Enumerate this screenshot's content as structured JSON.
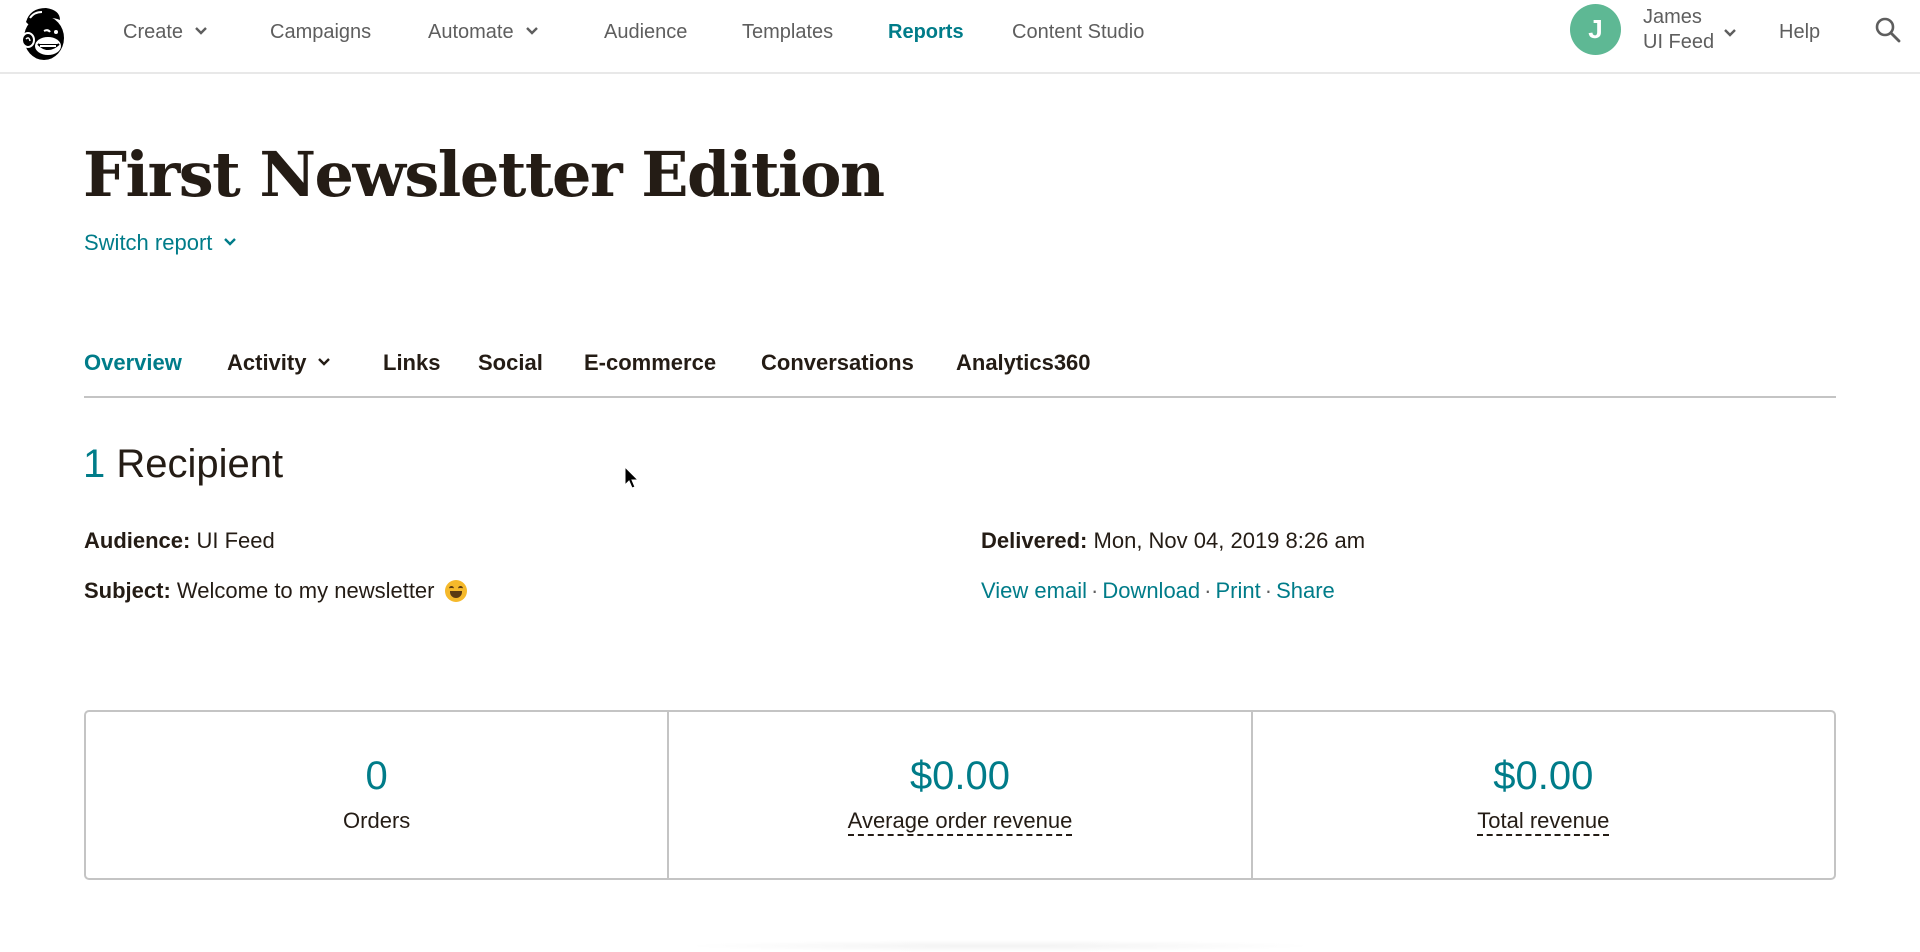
{
  "nav": {
    "logo_label": "Mailchimp",
    "items": [
      {
        "label": "Create",
        "has_dropdown": true
      },
      {
        "label": "Campaigns",
        "has_dropdown": false
      },
      {
        "label": "Automate",
        "has_dropdown": true
      },
      {
        "label": "Audience",
        "has_dropdown": false
      },
      {
        "label": "Templates",
        "has_dropdown": false
      },
      {
        "label": "Reports",
        "has_dropdown": false,
        "active": true
      },
      {
        "label": "Content Studio",
        "has_dropdown": false
      }
    ],
    "user": {
      "avatar_initial": "J",
      "avatar_color": "#5eb894",
      "name": "James",
      "account": "UI Feed"
    },
    "help_label": "Help",
    "search_icon": "search-icon"
  },
  "page": {
    "title": "First Newsletter Edition",
    "switch_report_label": "Switch report"
  },
  "tabs": [
    {
      "label": "Overview",
      "active": true
    },
    {
      "label": "Activity",
      "has_dropdown": true
    },
    {
      "label": "Links"
    },
    {
      "label": "Social"
    },
    {
      "label": "E-commerce"
    },
    {
      "label": "Conversations"
    },
    {
      "label": "Analytics360"
    }
  ],
  "summary": {
    "recipient_count": "1",
    "recipient_label": "Recipient",
    "audience_label": "Audience:",
    "audience_value": "UI Feed",
    "subject_label": "Subject:",
    "subject_value": "Welcome to my newsletter",
    "subject_emoji": "grinning-face-emoji",
    "delivered_label": "Delivered:",
    "delivered_value": "Mon, Nov 04, 2019 8:26 am",
    "actions": [
      {
        "label": "View email"
      },
      {
        "label": "Download"
      },
      {
        "label": "Print"
      },
      {
        "label": "Share"
      }
    ],
    "action_separator": "·"
  },
  "stats": [
    {
      "value": "0",
      "label": "Orders",
      "tooltip": false
    },
    {
      "value": "$0.00",
      "label": "Average order revenue",
      "tooltip": true
    },
    {
      "value": "$0.00",
      "label": "Total revenue",
      "tooltip": true
    }
  ],
  "colors": {
    "accent": "#007c89",
    "text": "#241c15",
    "nav_text": "#5e5e5e",
    "border": "#c4c4c4"
  }
}
